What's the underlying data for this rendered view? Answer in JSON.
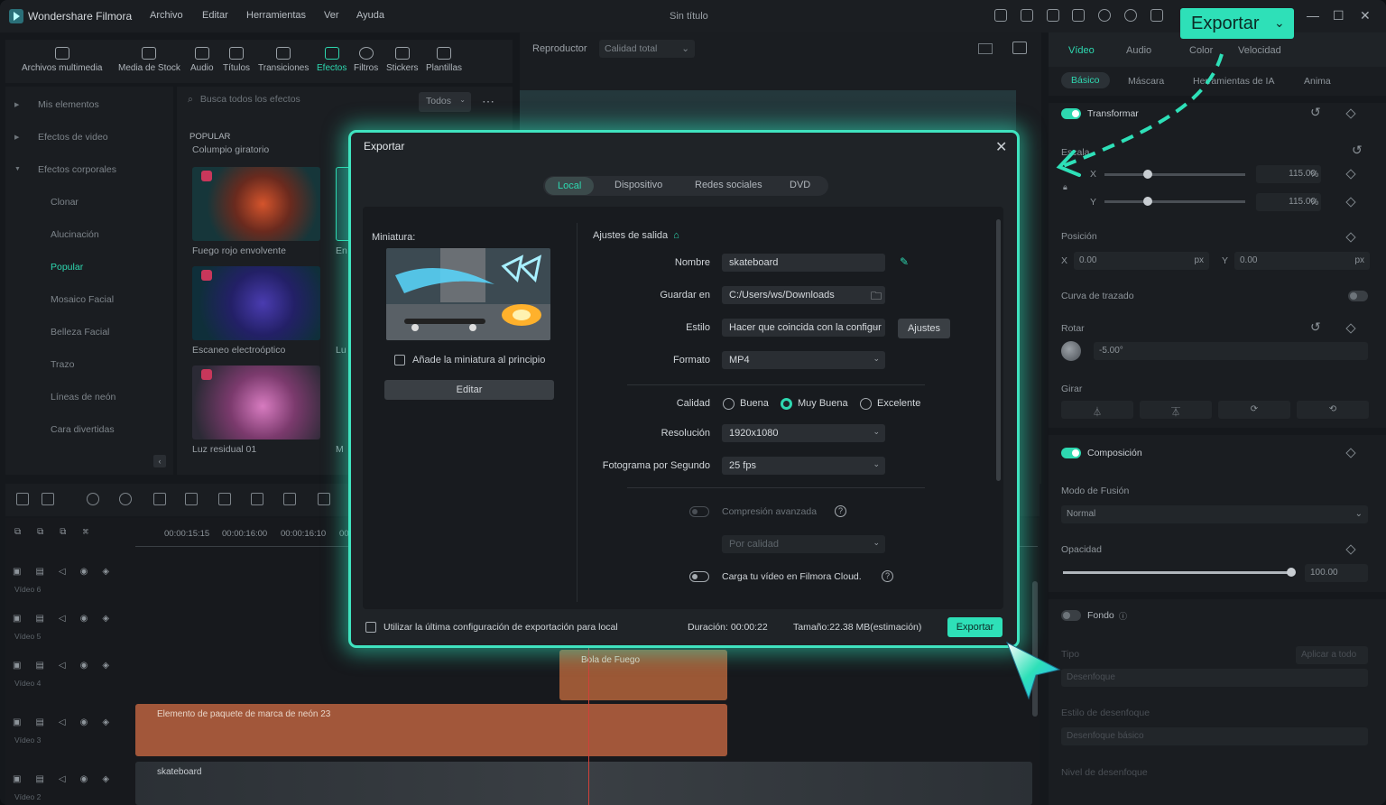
{
  "app": {
    "name": "Wondershare Filmora",
    "window_title": "Sin título",
    "menu": [
      "Archivo",
      "Editar",
      "Herramientas",
      "Ver",
      "Ayuda"
    ],
    "export_button": "Exportar",
    "accent_color": "#2ee0b8"
  },
  "library": {
    "toolbar": [
      "Archivos multimedia",
      "Media de Stock",
      "Audio",
      "Títulos",
      "Transiciones",
      "Efectos",
      "Filtros",
      "Stickers",
      "Plantillas"
    ],
    "sidebar": [
      "Mis elementos",
      "Efectos de video",
      "Efectos corporales",
      "Clonar",
      "Alucinación",
      "Popular",
      "Mosaico Facial",
      "Belleza Facial",
      "Trazo",
      "Líneas de neón",
      "Cara divertidas"
    ],
    "search_placeholder": "Busca todos los efectos",
    "filter": "Todos",
    "section": "POPULAR",
    "partial_caption": "Columpio giratorio",
    "effects": [
      "Fuego rojo envolvente",
      "Escaneo electroóptico",
      "Luz residual 01"
    ],
    "second_col": [
      "En",
      "Lu",
      "M"
    ]
  },
  "player": {
    "label": "Reproductor",
    "quality": "Calidad total"
  },
  "properties": {
    "tabs": [
      "Vídeo",
      "Audio",
      "Color",
      "Velocidad"
    ],
    "subtabs": [
      "Básico",
      "Máscara",
      "Herramientas de IA",
      "Anima"
    ],
    "transformar": "Transformar",
    "escala": "Escala",
    "x_label": "X",
    "y_label": "Y",
    "scale_x": "115.00",
    "scale_y": "115.00",
    "pct": "%",
    "posicion": "Posición",
    "pos_x": "0.00",
    "pos_y": "0.00",
    "px": "px",
    "curva": "Curva de trazado",
    "rotar": "Rotar",
    "rotar_val": "-5.00°",
    "girar": "Girar",
    "composicion": "Composición",
    "modo_fusion": "Modo de Fusión",
    "modo_val": "Normal",
    "opacidad": "Opacidad",
    "opacidad_val": "100.00",
    "fondo": "Fondo",
    "tipo": "Tipo",
    "aplicar": "Aplicar a todo",
    "desenfoque": "Desenfoque",
    "estilo_desenfoque": "Estilo de desenfoque",
    "desenfoque_basico": "Desenfoque básico",
    "nivel": "Nivel de desenfoque"
  },
  "timeline": {
    "timecodes": [
      "00:00:15:15",
      "00:00:16:00",
      "00:00:16:10",
      "00"
    ],
    "tracks": [
      "Vídeo 6",
      "Vídeo 5",
      "Vídeo 4",
      "Vídeo 3",
      "Vídeo 2"
    ],
    "clip_fire": "Bola de Fuego",
    "clip_neon": "Elemento de paquete de marca de neón 23",
    "clip_skate": "skateboard"
  },
  "export_dialog": {
    "title": "Exportar",
    "tabs": [
      "Local",
      "Dispositivo",
      "Redes sociales",
      "DVD"
    ],
    "active_tab": "Local",
    "thumbnail_label": "Miniatura:",
    "add_thumb": "Añade la miniatura al principio",
    "edit": "Editar",
    "output_settings": "Ajustes de salida",
    "name_label": "Nombre",
    "name_value": "skateboard",
    "save_label": "Guardar en",
    "save_value": "C:/Users/ws/Downloads",
    "style_label": "Estilo",
    "style_value": "Hacer que coincida con la configur",
    "settings_btn": "Ajustes",
    "format_label": "Formato",
    "format_value": "MP4",
    "quality_label": "Calidad",
    "quality_options": [
      "Buena",
      "Muy Buena",
      "Excelente"
    ],
    "quality_selected": "Muy Buena",
    "resolution_label": "Resolución",
    "resolution_value": "1920x1080",
    "fps_label": "Fotograma por Segundo",
    "fps_value": "25 fps",
    "advanced_compression": "Compresión avanzada",
    "by_quality": "Por calidad",
    "cloud_upload": "Carga tu vídeo en Filmora Cloud.",
    "use_last": "Utilizar la última configuración de exportación para local",
    "duration": "Duración: 00:00:22",
    "size": "Tamaño:22.38 MB(estimación)",
    "export": "Exportar"
  }
}
